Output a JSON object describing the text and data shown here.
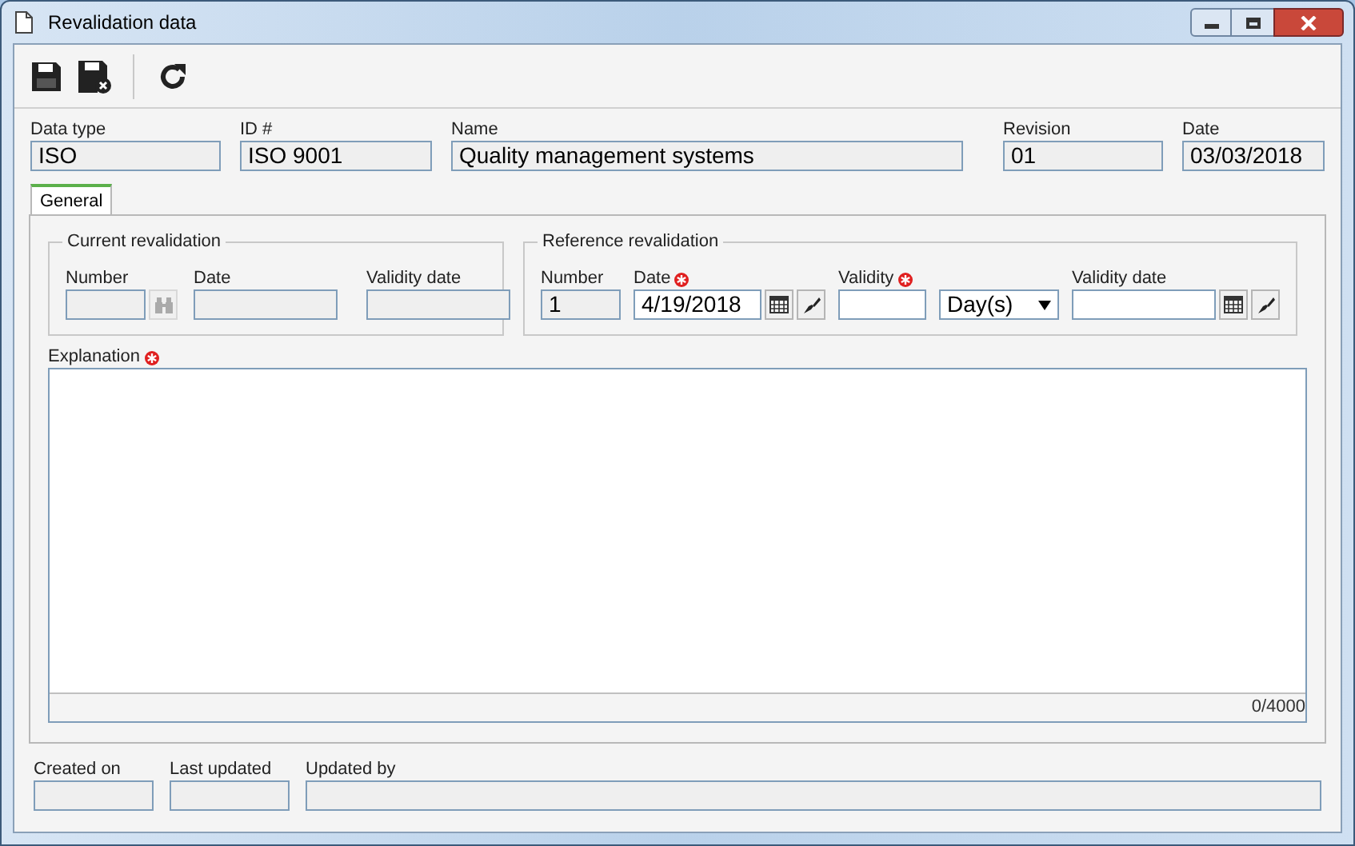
{
  "window": {
    "title": "Revalidation data"
  },
  "header_fields": [
    {
      "label": "Data type",
      "value": "ISO"
    },
    {
      "label": "ID #",
      "value": "ISO 9001"
    },
    {
      "label": "Name",
      "value": "Quality management systems"
    },
    {
      "label": "Revision",
      "value": "01"
    },
    {
      "label": "Date",
      "value": "03/03/2018"
    }
  ],
  "tabs": [
    {
      "label": "General",
      "selected": true
    }
  ],
  "current_revalidation": {
    "title": "Current revalidation",
    "number_label": "Number",
    "date_label": "Date",
    "validity_date_label": "Validity date"
  },
  "reference_revalidation": {
    "title": "Reference revalidation",
    "number": {
      "label": "Number",
      "value": "1"
    },
    "date": {
      "label": "Date",
      "value": "4/19/2018",
      "required": true
    },
    "validity": {
      "label": "Validity",
      "required": true
    },
    "unit": {
      "value": "Day(s)"
    },
    "validity_date": {
      "label": "Validity date"
    }
  },
  "explanation": {
    "label": "Explanation",
    "required": true,
    "counter": "0/4000"
  },
  "footer_fields": [
    {
      "label": "Created on"
    },
    {
      "label": "Last updated"
    },
    {
      "label": "Updated by"
    }
  ]
}
